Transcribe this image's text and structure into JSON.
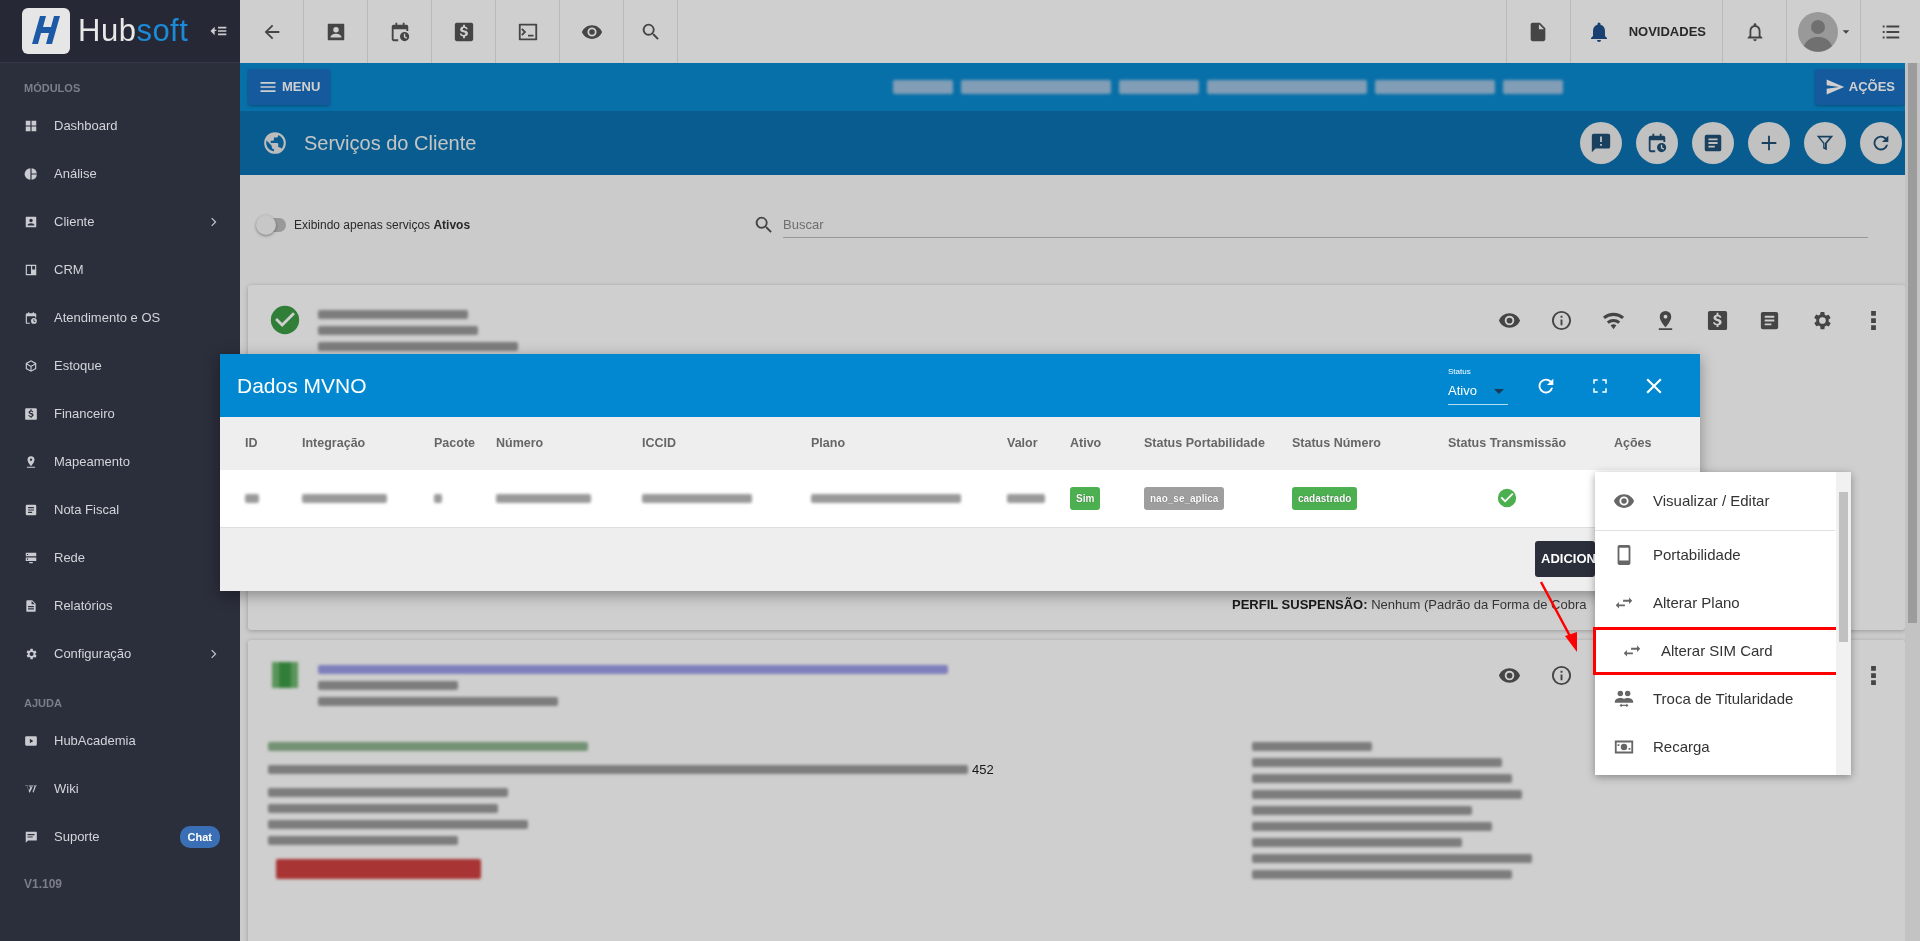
{
  "sidebar": {
    "logo": {
      "part_1": "Hub",
      "part_2": "soft"
    },
    "sections": [
      {
        "title": "MÓDULOS",
        "items": [
          {
            "label": "Dashboard",
            "has_submenu": false
          },
          {
            "label": "Análise",
            "has_submenu": false
          },
          {
            "label": "Cliente",
            "has_submenu": true
          },
          {
            "label": "CRM",
            "has_submenu": false
          },
          {
            "label": "Atendimento e OS",
            "has_submenu": false
          },
          {
            "label": "Estoque",
            "has_submenu": false
          },
          {
            "label": "Financeiro",
            "has_submenu": false
          },
          {
            "label": "Mapeamento",
            "has_submenu": false
          },
          {
            "label": "Nota Fiscal",
            "has_submenu": false
          },
          {
            "label": "Rede",
            "has_submenu": false
          },
          {
            "label": "Relatórios",
            "has_submenu": false
          },
          {
            "label": "Configuração",
            "has_submenu": true
          }
        ]
      },
      {
        "title": "AJUDA",
        "items": [
          {
            "label": "HubAcademia",
            "has_submenu": false
          },
          {
            "label": "Wiki",
            "has_submenu": false
          },
          {
            "label": "Suporte",
            "has_submenu": false,
            "badge": "Chat"
          }
        ]
      }
    ],
    "version": "V1.109"
  },
  "topbar": {
    "news_label": "NOVIDADES"
  },
  "action_bar": {
    "menu_button": "MENU",
    "actions_button": "AÇÕES"
  },
  "page_header": {
    "title": "Serviços do Cliente"
  },
  "filters": {
    "toggle": {
      "label": "Exibindo apenas serviços **Ativos**",
      "on": false
    },
    "search": {
      "placeholder": "Buscar"
    }
  },
  "cards": [
    {
      "status_ok": true
    },
    {
      "status_ok": false,
      "visible_text": "452"
    }
  ],
  "card_footer": {
    "label": "PERFIL SUSPENSÃO:",
    "value": "Nenhum (Padrão da Forma de Cobra"
  },
  "modal": {
    "title": "Dados MVNO",
    "status_select": {
      "label": "Status",
      "value": "Ativo"
    },
    "columns": [
      "ID",
      "Integração",
      "Pacote",
      "Número",
      "ICCID",
      "Plano",
      "Valor",
      "Ativo",
      "Status Portabilidade",
      "Status Número",
      "Status Transmissão",
      "Ações"
    ],
    "rows": [
      {
        "ativo": {
          "text": "Sim",
          "color": "#4caf50"
        },
        "status_portabilidade": {
          "text": "nao_se_aplica",
          "color": "#9e9e9e"
        },
        "status_numero": {
          "text": "cadastrado",
          "color": "#4caf50"
        },
        "transmissao_ok": true
      }
    ],
    "footer_button": "ADICION"
  },
  "menu": {
    "items": [
      {
        "label": "Visualizar / Editar",
        "highlighted": false
      },
      {
        "label": "Portabilidade",
        "highlighted": false
      },
      {
        "label": "Alterar Plano",
        "highlighted": false
      },
      {
        "label": "Alterar SIM Card",
        "highlighted": true
      },
      {
        "label": "Troca de Titularidade",
        "highlighted": false
      },
      {
        "label": "Recarga",
        "highlighted": false
      }
    ]
  }
}
